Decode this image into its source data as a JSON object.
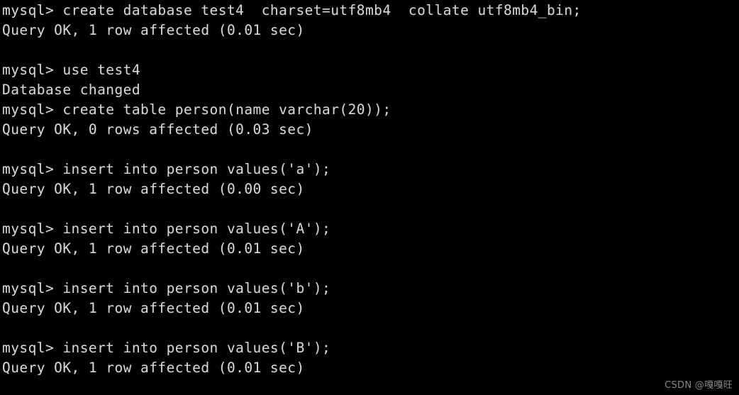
{
  "terminal": {
    "background_color": "#000000",
    "text_color": "#d6d6d6",
    "prompt": "mysql>",
    "lines": [
      {
        "type": "command",
        "text": "mysql> create database test4  charset=utf8mb4  collate utf8mb4_bin;"
      },
      {
        "type": "result",
        "text": "Query OK, 1 row affected (0.01 sec)"
      },
      {
        "type": "blank",
        "text": ""
      },
      {
        "type": "command",
        "text": "mysql> use test4"
      },
      {
        "type": "result",
        "text": "Database changed"
      },
      {
        "type": "command",
        "text": "mysql> create table person(name varchar(20));"
      },
      {
        "type": "result",
        "text": "Query OK, 0 rows affected (0.03 sec)"
      },
      {
        "type": "blank",
        "text": ""
      },
      {
        "type": "command",
        "text": "mysql> insert into person values('a');"
      },
      {
        "type": "result",
        "text": "Query OK, 1 row affected (0.00 sec)"
      },
      {
        "type": "blank",
        "text": ""
      },
      {
        "type": "command",
        "text": "mysql> insert into person values('A');"
      },
      {
        "type": "result",
        "text": "Query OK, 1 row affected (0.01 sec)"
      },
      {
        "type": "blank",
        "text": ""
      },
      {
        "type": "command",
        "text": "mysql> insert into person values('b');"
      },
      {
        "type": "result",
        "text": "Query OK, 1 row affected (0.01 sec)"
      },
      {
        "type": "blank",
        "text": ""
      },
      {
        "type": "command",
        "text": "mysql> insert into person values('B');"
      },
      {
        "type": "result",
        "text": "Query OK, 1 row affected (0.01 sec)"
      }
    ]
  },
  "watermark": {
    "text": "CSDN @嘎嘎旺",
    "color": "#8a8a8a"
  }
}
